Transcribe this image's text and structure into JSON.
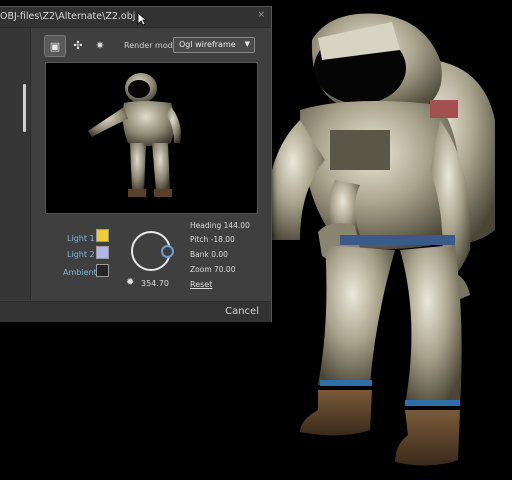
{
  "window": {
    "title": "OBJ-files\\Z2\\Alternate\\Z2.obj",
    "close_glyph": "×"
  },
  "toolbar": {
    "buttons": [
      {
        "icon": "camera-icon",
        "glyph": "▣"
      },
      {
        "icon": "lights-icon",
        "glyph": "✣"
      },
      {
        "icon": "settings-icon",
        "glyph": "✷"
      }
    ],
    "render_mode_label": "Render mode",
    "render_mode_value": "Ogl wireframe"
  },
  "lights": [
    {
      "label": "Light 1",
      "color": "#f2cc2e"
    },
    {
      "label": "Light 2",
      "color": "#b3b4e8"
    },
    {
      "label": "Ambient",
      "color": "#262626"
    }
  ],
  "dial": {
    "value": "354.70"
  },
  "orientation": {
    "heading": "Heading 144.00",
    "pitch": "Pitch -18.00",
    "bank": "Bank 0.00",
    "zoom": "Zoom 70.00",
    "reset": "Reset"
  },
  "footer": {
    "cancel_label": "Cancel"
  },
  "colors": {
    "dialog_bg": "#3f3f3f",
    "accent_blue": "#6a9fd0"
  }
}
